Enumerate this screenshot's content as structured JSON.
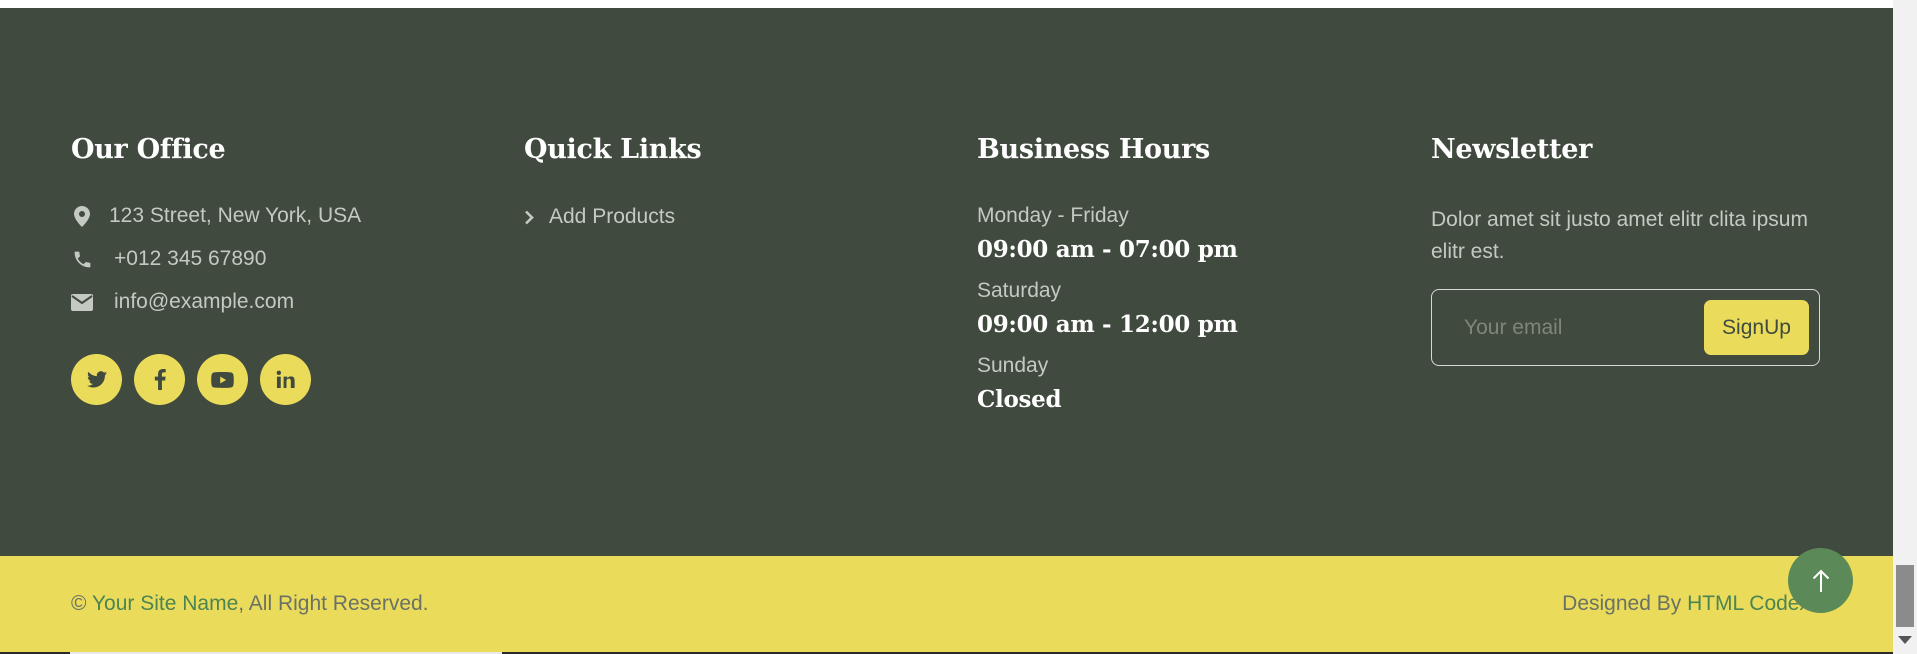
{
  "office": {
    "title": "Our Office",
    "address": "123 Street, New York, USA",
    "phone": "+012 345 67890",
    "email": "info@example.com",
    "socials": [
      "twitter-icon",
      "facebook-icon",
      "youtube-icon",
      "linkedin-icon"
    ]
  },
  "quick_links": {
    "title": "Quick Links",
    "items": [
      {
        "label": "Add Products"
      }
    ]
  },
  "hours": {
    "title": "Business Hours",
    "rows": [
      {
        "day": "Monday - Friday",
        "time": "09:00 am - 07:00 pm"
      },
      {
        "day": "Saturday",
        "time": "09:00 am - 12:00 pm"
      },
      {
        "day": "Sunday",
        "time": "Closed"
      }
    ]
  },
  "newsletter": {
    "title": "Newsletter",
    "text": "Dolor amet sit justo amet elitr clita ipsum elitr est.",
    "placeholder": "Your email",
    "button": "SignUp"
  },
  "bottom": {
    "copyright_symbol": "©",
    "site_name": "Your Site Name",
    "rights": ", All Right Reserved.",
    "designed_by": "Designed By ",
    "designer": "HTML Codex"
  },
  "colors": {
    "footer_bg": "#404a3e",
    "accent": "#eadc5a",
    "link": "#4c8452",
    "back_to_top": "#5b8a58"
  }
}
